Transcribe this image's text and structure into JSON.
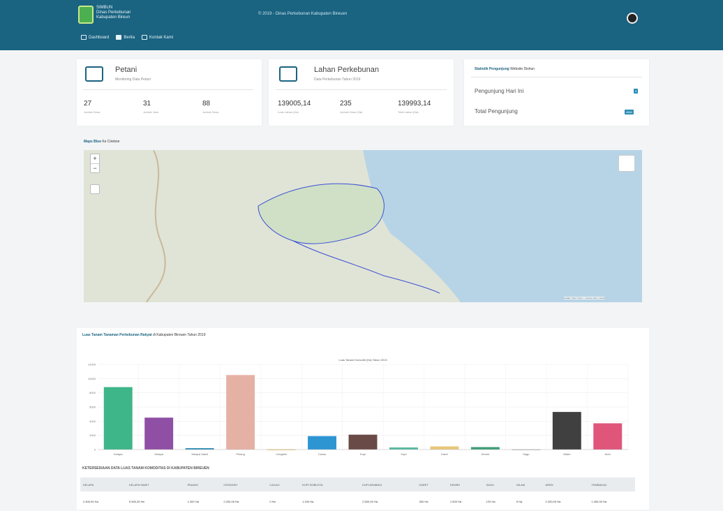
{
  "header": {
    "brand_lines": [
      "SIMBUN",
      "Dinas Perkebunan",
      "Kabupaten Bireun"
    ],
    "center_text": "© 2019 - Dinas Perkebunan Kabupaten Bireuen",
    "nav": [
      {
        "label": "Dashboard",
        "icon": "menu-icon"
      },
      {
        "label": "Berita",
        "icon": "thumb-icon"
      },
      {
        "label": "Kontak Kami",
        "icon": "calendar-icon"
      }
    ]
  },
  "stats": {
    "petani": {
      "title": "Petani",
      "subtitle": "Monitoring Data Petani",
      "items": [
        {
          "value": "27",
          "label": "Jumlah Desa"
        },
        {
          "value": "31",
          "label": "Jumlah Jiwa"
        },
        {
          "value": "88",
          "label": "Jumlah Desa"
        }
      ]
    },
    "lahan": {
      "title": "Lahan Perkebunan",
      "subtitle": "Data Perkebunan Tahun 2019",
      "items": [
        {
          "value": "139005,14",
          "label": "Luas Lahan (Ha)"
        },
        {
          "value": "235",
          "label": "Jumlah Desa (Ha)"
        },
        {
          "value": "139993,14",
          "label": "Total Lahan (Ha)"
        }
      ]
    },
    "pengunjung": {
      "title_strong": "Statistik Pengunjung",
      "title_sub": "Website Dishun",
      "rows": [
        {
          "label": "Pengunjung Hari Ini",
          "badge": "5"
        },
        {
          "label": "Total Pengunjung",
          "badge": "4884"
        }
      ]
    }
  },
  "map": {
    "label_strong": "Maps Blue",
    "label_sub": "Ke Cirebon",
    "attribution": "Leaflet | Tiles © Esri — Source: Esri, i-cubed"
  },
  "chart_section": {
    "heading_strong": "Luas Tanam Tanaman Perkebunan Rakyat",
    "heading_sub": "di Kabupaten Bireuen Tahun 2019",
    "chart_title": "Luas Tanam Komoditi (Ha) Tahun 2019"
  },
  "chart_data": {
    "type": "bar",
    "categories": [
      "Kelapa",
      "Kelapa",
      "Kelapa Sawit",
      "Pinang",
      "Cengkeh",
      "Cacao",
      "Kopi",
      "Kopi",
      "Karet",
      "Kemiri",
      "Sagu",
      "Nilam",
      "Aren"
    ],
    "values": [
      8800,
      4500,
      200,
      10500,
      30,
      1900,
      2100,
      300,
      450,
      350,
      30,
      5300,
      3700
    ],
    "colors": [
      "#3fb58a",
      "#8e4fa5",
      "#2d8db5",
      "#e6b1a5",
      "#d8a536",
      "#2e95d3",
      "#6a4a46",
      "#57b8a0",
      "#e8c77a",
      "#3f9e77",
      "#999999",
      "#404040",
      "#e0557a"
    ],
    "ylim": [
      0,
      12000
    ],
    "yticks": [
      "0",
      "2000",
      "4000",
      "6000",
      "8000",
      "10000",
      "12000"
    ],
    "ylabel": "",
    "xlabel": "",
    "grid": true
  },
  "table": {
    "title": "KETERSEDIAAN DATA LUAS TANAM KOMODITAS DI KABUPATEN BIREUEN",
    "headers": [
      "KELAPA",
      "KELAPA SAWIT",
      "PINANG",
      "CENGKEH",
      "CACAO",
      "KOPI ROBUSTA",
      "KOPI ARABIKA",
      "KARET",
      "KEMIRI",
      "SAGU",
      "NILAM",
      "AREN",
      "TEMBAKAU"
    ],
    "rows": [
      [
        "2.400,00 Ha",
        "5.500,30 Ha",
        "1.300 Ha",
        "2.200,00 Ha",
        "0 Ha",
        "1.150 Ha",
        "2.500,00 Ha",
        "300 Ha",
        "1.500 Ha",
        "120 Ha",
        "5 Ha",
        "2.200,00 Ha",
        "1.400,00 Ha"
      ]
    ]
  },
  "colors": {
    "primary": "#1a6381",
    "accent": "#2d8db5"
  }
}
